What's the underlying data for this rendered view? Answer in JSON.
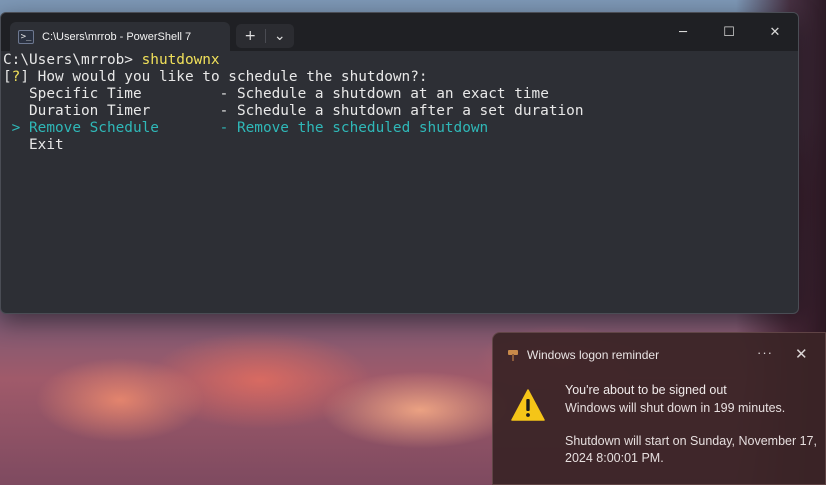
{
  "terminal": {
    "tab_title": "C:\\Users\\mrrob - PowerShell 7",
    "tab_icon": ">_",
    "new_tab": "+",
    "dropdown": "⌄",
    "window_controls": {
      "minimize": "─",
      "maximize": "☐",
      "close": "✕"
    },
    "prompt": "C:\\Users\\mrrob> ",
    "command": "shutdownx",
    "question_prefix_open": "[",
    "question_mark": "?",
    "question_prefix_close": "] ",
    "question": "How would you like to schedule the shutdown?:",
    "options": [
      {
        "name": "Specific Time",
        "desc": "Schedule a shutdown at an exact time",
        "selected": false
      },
      {
        "name": "Duration Timer",
        "desc": "Schedule a shutdown after a set duration",
        "selected": false
      },
      {
        "name": "Remove Schedule",
        "desc": "Remove the scheduled shutdown",
        "selected": true
      },
      {
        "name": "Exit",
        "desc": "",
        "selected": false
      }
    ],
    "selector": ">"
  },
  "toast": {
    "app_name": "Windows logon reminder",
    "more": "···",
    "close": "✕",
    "title": "You're about to be signed out",
    "line2": "Windows will shut down in 199 minutes.",
    "line3": " Shutdown will start on Sunday, November 17, 2024 8:00:01 PM.",
    "icon": "warning-icon"
  },
  "colors": {
    "terminal_bg": "#2d2f35",
    "prompt_command": "#f0e05a",
    "selected": "#2fb8b8",
    "warning": "#f5c518"
  }
}
